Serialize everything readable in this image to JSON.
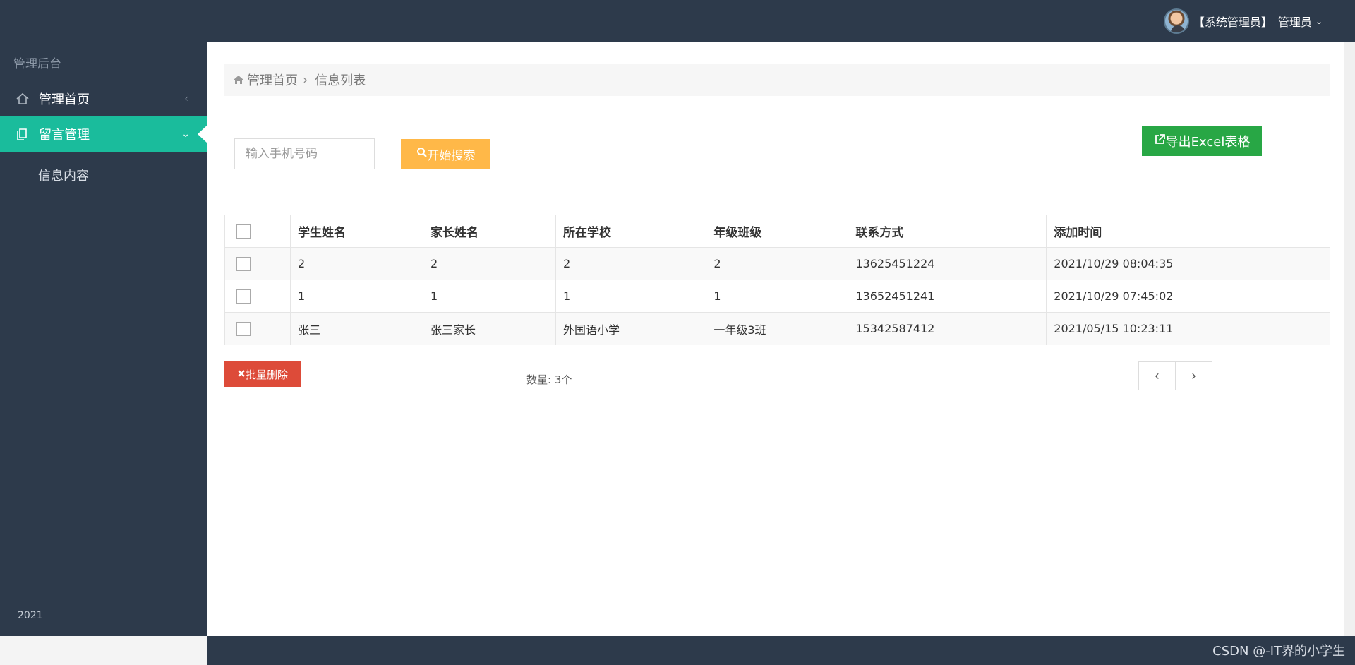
{
  "topbar": {
    "user_role": "【系统管理员】",
    "user_name": "管理员",
    "chevron": "⌄"
  },
  "sidebar": {
    "title": "管理后台",
    "items": [
      {
        "label": "管理首页",
        "icon": "home-icon",
        "arrow": "‹"
      },
      {
        "label": "留言管理",
        "icon": "document-icon",
        "arrow": "⌄",
        "active": true
      }
    ],
    "sub_item": "信息内容",
    "footer": "2021"
  },
  "breadcrumb": {
    "home": "管理首页",
    "current": "信息列表"
  },
  "search": {
    "placeholder": "输入手机号码",
    "button": "开始搜索"
  },
  "export_button": "导出Excel表格",
  "table": {
    "headers": [
      "学生姓名",
      "家长姓名",
      "所在学校",
      "年级班级",
      "联系方式",
      "添加时间"
    ],
    "rows": [
      [
        "2",
        "2",
        "2",
        "2",
        "13625451224",
        "2021/10/29 08:04:35"
      ],
      [
        "1",
        "1",
        "1",
        "1",
        "13652451241",
        "2021/10/29 07:45:02"
      ],
      [
        "张三",
        "张三家长",
        "外国语小学",
        "一年级3班",
        "15342587412",
        "2021/05/15 10:23:11"
      ]
    ]
  },
  "batch_delete": "批量删除",
  "count": "数量: 3个",
  "pagination": {
    "prev": "‹",
    "next": "›"
  },
  "watermark": "CSDN @-IT界的小学生",
  "colors": {
    "sidebar_bg": "#2d3a4b",
    "active_nav": "#1abc9c",
    "search_button": "#ffb848",
    "export_button": "#28a745",
    "delete_button": "#dd4b39"
  }
}
